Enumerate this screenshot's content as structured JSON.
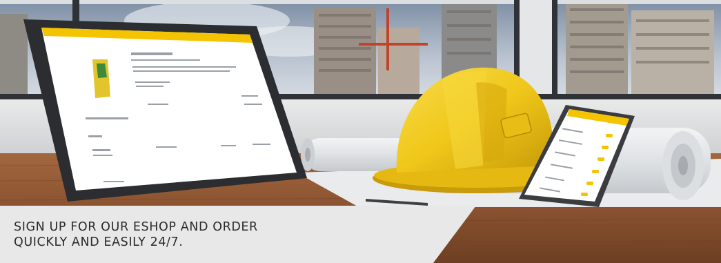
{
  "banner": {
    "caption_line1": "SIGN UP FOR OUR ESHOP AND ORDER",
    "caption_line2": "QUICKLY AND EASILY 24/7."
  },
  "colors": {
    "brand_yellow": "#f5c400",
    "caption_bg": "#e8e8e8",
    "caption_text": "#2a2a2a",
    "wood": "#8a5230"
  },
  "icons": [
    "hard-hat-icon",
    "tablet-device",
    "smartphone-device",
    "blueprint-rolls",
    "pencil-icon"
  ]
}
